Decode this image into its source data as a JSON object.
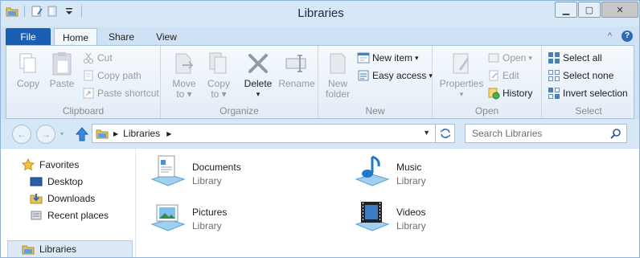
{
  "window": {
    "title": "Libraries"
  },
  "tabs": {
    "file": "File",
    "home": "Home",
    "share": "Share",
    "view": "View"
  },
  "ribbon": {
    "clipboard": {
      "label": "Clipboard",
      "copy": "Copy",
      "paste": "Paste",
      "cut": "Cut",
      "copy_path": "Copy path",
      "paste_shortcut": "Paste shortcut"
    },
    "organize": {
      "label": "Organize",
      "move_to_1": "Move",
      "move_to_2": "to",
      "copy_to_1": "Copy",
      "copy_to_2": "to",
      "delete": "Delete",
      "rename": "Rename"
    },
    "new": {
      "label": "New",
      "new_folder_1": "New",
      "new_folder_2": "folder",
      "new_item": "New item",
      "easy_access": "Easy access"
    },
    "open": {
      "label": "Open",
      "properties": "Properties",
      "open": "Open",
      "edit": "Edit",
      "history": "History"
    },
    "select": {
      "label": "Select",
      "select_all": "Select all",
      "select_none": "Select none",
      "invert_selection": "Invert selection"
    }
  },
  "address": {
    "crumb": "Libraries"
  },
  "search": {
    "placeholder": "Search Libraries"
  },
  "nav": {
    "favorites": "Favorites",
    "desktop": "Desktop",
    "downloads": "Downloads",
    "recent_places": "Recent places",
    "libraries": "Libraries"
  },
  "libraries": [
    {
      "name": "Documents",
      "kind": "Library",
      "icon": "documents-library-icon"
    },
    {
      "name": "Music",
      "kind": "Library",
      "icon": "music-library-icon"
    },
    {
      "name": "Pictures",
      "kind": "Library",
      "icon": "pictures-library-icon"
    },
    {
      "name": "Videos",
      "kind": "Library",
      "icon": "videos-library-icon"
    }
  ]
}
